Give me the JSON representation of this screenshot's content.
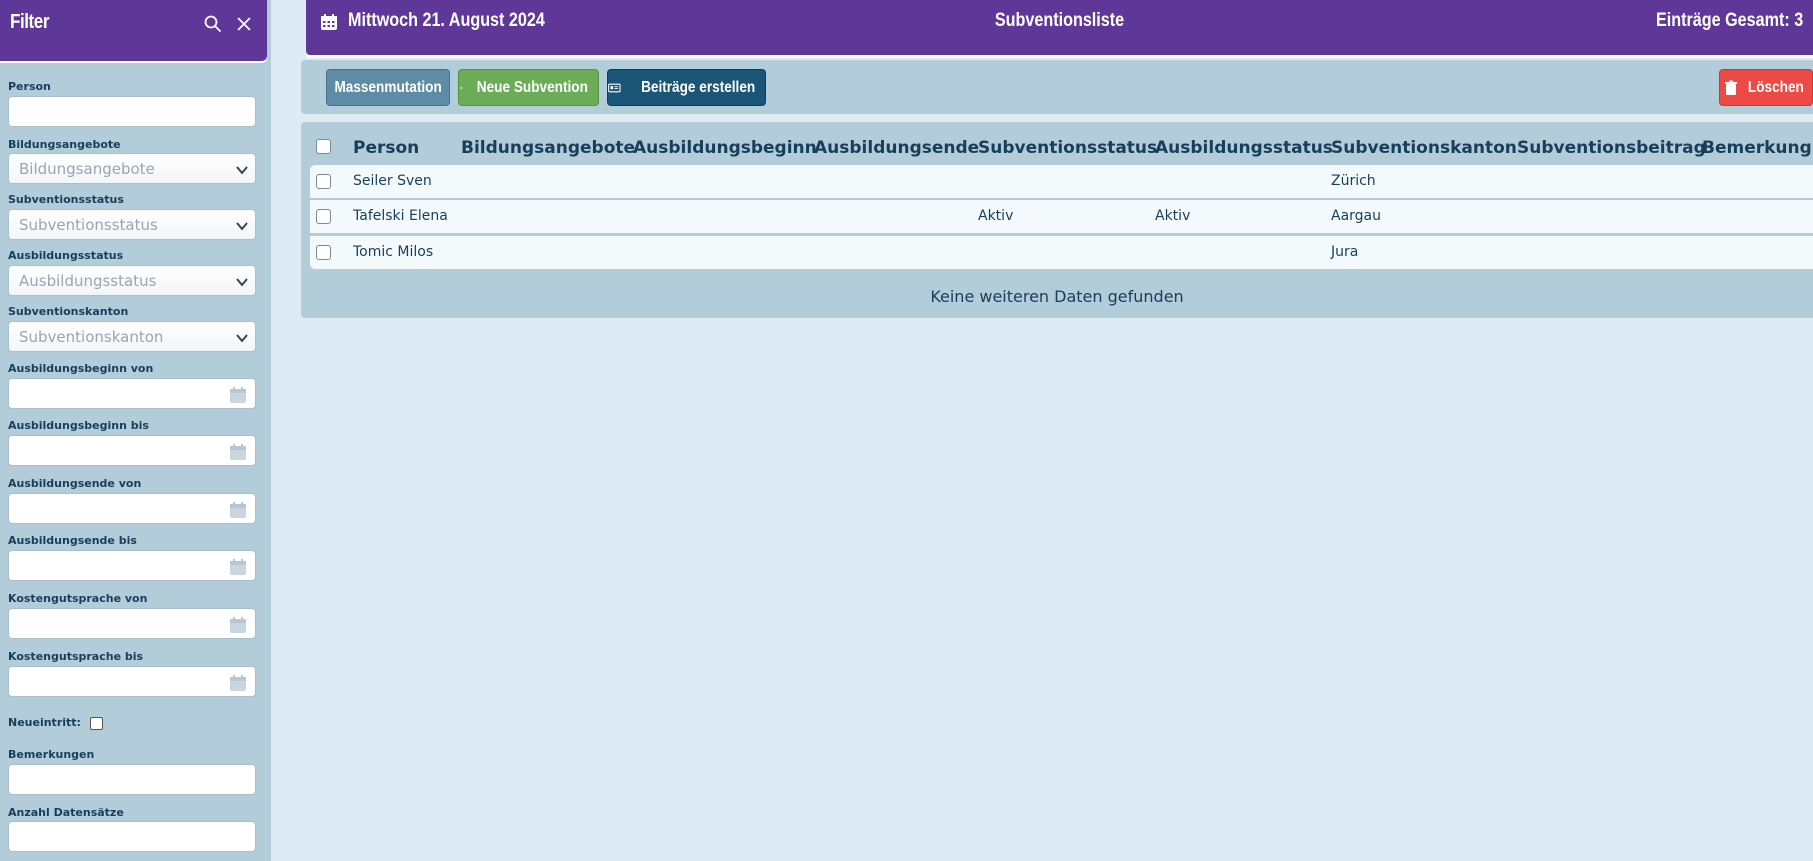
{
  "sidebar": {
    "title": "Filter",
    "filters": {
      "person": {
        "label": "Person",
        "value": ""
      },
      "bildungsangebote": {
        "label": "Bildungsangebote",
        "placeholder": "Bildungsangebote"
      },
      "subventionsstatus": {
        "label": "Subventionsstatus",
        "placeholder": "Subventionsstatus"
      },
      "ausbildungsstatus": {
        "label": "Ausbildungsstatus",
        "placeholder": "Ausbildungsstatus"
      },
      "subventionskanton": {
        "label": "Subventionskanton",
        "placeholder": "Subventionskanton"
      },
      "ausbildungsbeginn_von": {
        "label": "Ausbildungsbeginn von",
        "value": ""
      },
      "ausbildungsbeginn_bis": {
        "label": "Ausbildungsbeginn bis",
        "value": ""
      },
      "ausbildungsende_von": {
        "label": "Ausbildungsende von",
        "value": ""
      },
      "ausbildungsende_bis": {
        "label": "Ausbildungsende bis",
        "value": ""
      },
      "kostengutsprache_von": {
        "label": "Kostengutsprache von",
        "value": ""
      },
      "kostengutsprache_bis": {
        "label": "Kostengutsprache bis",
        "value": ""
      },
      "neueintritt": {
        "label": "Neueintritt:",
        "checked": false
      },
      "bemerkungen": {
        "label": "Bemerkungen",
        "value": ""
      },
      "anzahl": {
        "label": "Anzahl Datensätze",
        "value": ""
      }
    }
  },
  "topbar": {
    "date": "Mittwoch 21. August 2024",
    "title": "Subventionsliste",
    "count": "Einträge Gesamt: 3"
  },
  "toolbar": {
    "mass_label": "Massenmutation",
    "new_label": "Neue Subvention",
    "beitrag_label": "Beiträge erstellen",
    "delete_label": "Löschen"
  },
  "table": {
    "columns": [
      "Person",
      "Bildungsangebote",
      "Ausbildungsbeginn",
      "Ausbildungsende",
      "Subventionsstatus",
      "Ausbildungsstatus",
      "Subventionskanton",
      "Subventionsbeitrag",
      "Bemerkung"
    ],
    "rows": [
      {
        "person": "Seiler Sven",
        "subventionsstatus": "",
        "ausbildungsstatus": "",
        "kanton": "Zürich"
      },
      {
        "person": "Tafelski Elena",
        "subventionsstatus": "Aktiv",
        "ausbildungsstatus": "Aktiv",
        "kanton": "Aargau"
      },
      {
        "person": "Tomic Milos",
        "subventionsstatus": "",
        "ausbildungsstatus": "",
        "kanton": "Jura"
      }
    ],
    "empty_message": "Keine weiteren Daten gefunden"
  },
  "colors": {
    "header": "#5f3799",
    "panel": "#b3ccda",
    "background": "#deebf4",
    "new_button": "#6aad56",
    "delete_button": "#ee4a45",
    "beitrag_button": "#1a5577",
    "mass_button": "#5e8ba6"
  }
}
